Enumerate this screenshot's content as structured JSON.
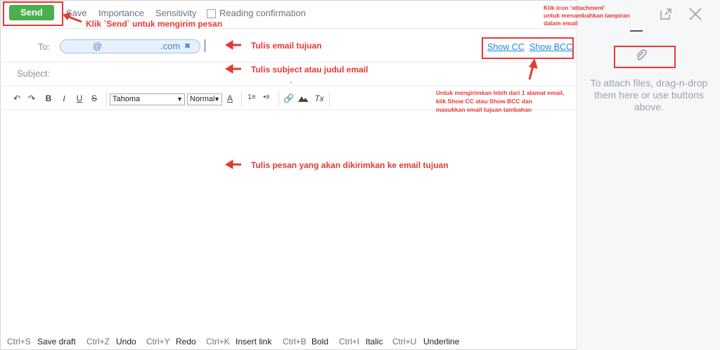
{
  "toolbar_top": {
    "send": "Send",
    "save": "Save",
    "importance": "Importance",
    "sensitivity": "Sensitivity",
    "reading_confirmation": "Reading confirmation"
  },
  "compose": {
    "to_label": "To:",
    "to_chip_at": "@",
    "to_chip_domain": ".com",
    "to_chip_remove": "✖",
    "show_cc": "Show CC",
    "show_bcc": "Show BCC",
    "subject_label": "Subject:"
  },
  "editor_toolbar": {
    "font": "Tahoma",
    "size": "Normal"
  },
  "side": {
    "attach_hint": "To attach files, drag-n-drop them here or use buttons above."
  },
  "shortcuts": [
    {
      "key": "Ctrl+S",
      "label": "Save draft"
    },
    {
      "key": "Ctrl+Z",
      "label": "Undo"
    },
    {
      "key": "Ctrl+Y",
      "label": "Redo"
    },
    {
      "key": "Ctrl+K",
      "label": "Insert link"
    },
    {
      "key": "Ctrl+B",
      "label": "Bold"
    },
    {
      "key": "Ctrl+I",
      "label": "Italic"
    },
    {
      "key": "Ctrl+U",
      "label": "Underline"
    }
  ],
  "annotations": {
    "send": "Klik `Send` untuk mengirim pesan",
    "to": "Tulis email tujuan",
    "subject": "Tulis subject atau judul email",
    "cc": [
      "Untuk mengirimkan lebih dari 1 alamat email,",
      "klik Show CC atau Show BCC dan",
      "masukkan email tujuan tambahan"
    ],
    "attach": [
      "Klik icon ‘attachment’",
      "untuk menambahkan lampiran",
      "dalam email"
    ],
    "body": "Tulis pesan yang akan dikirimkan ke email tujuan"
  },
  "colors": {
    "send_green": "#4cae4c",
    "annotation_red": "#e53935",
    "link_blue": "#1c8adb"
  }
}
